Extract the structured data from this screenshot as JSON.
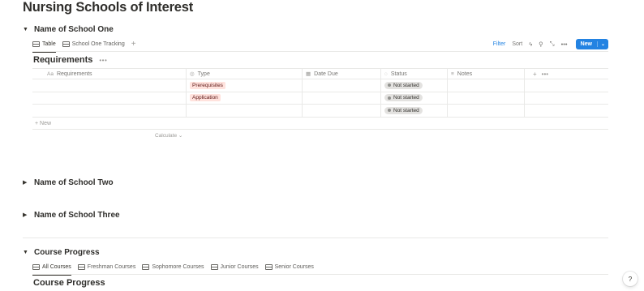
{
  "page": {
    "title": "Nursing Schools of Interest"
  },
  "school_one": {
    "title": "Name of School One",
    "tabs": [
      {
        "label": "Table",
        "icon": "table-icon"
      },
      {
        "label": "School One Tracking",
        "icon": "table-icon"
      }
    ],
    "toolbar": {
      "filter_label": "Filter",
      "sort_label": "Sort",
      "new_label": "New",
      "icons": [
        "lightning-icon",
        "search-icon",
        "expand-icon",
        "more-icon"
      ]
    },
    "database": {
      "title": "Requirements",
      "columns": [
        {
          "label": "Requirements",
          "icon": "text-icon"
        },
        {
          "label": "Type",
          "icon": "select-icon"
        },
        {
          "label": "Date Due",
          "icon": "calendar-icon"
        },
        {
          "label": "Status",
          "icon": "status-icon"
        },
        {
          "label": "Notes",
          "icon": "notes-icon"
        }
      ],
      "rows": [
        {
          "requirements": "",
          "type": "Prerequisites",
          "date_due": "",
          "status": "Not started",
          "notes": ""
        },
        {
          "requirements": "",
          "type": "Application",
          "date_due": "",
          "status": "Not started",
          "notes": ""
        },
        {
          "requirements": "",
          "type": "",
          "date_due": "",
          "status": "Not started",
          "notes": ""
        }
      ],
      "new_row_label": "+ New",
      "calculate_label": "Calculate"
    },
    "colors": {
      "accent": "#2383e2",
      "type_tag_bg": "#ffe2dd",
      "status_bg": "#e3e2e0"
    }
  },
  "school_two": {
    "title": "Name of School Two"
  },
  "school_three": {
    "title": "Name of School Three"
  },
  "course_progress": {
    "title": "Course Progress",
    "tabs": [
      {
        "label": "All Courses"
      },
      {
        "label": "Freshman Courses"
      },
      {
        "label": "Sophomore Courses"
      },
      {
        "label": "Junior Courses"
      },
      {
        "label": "Senior Courses"
      }
    ],
    "database_title": "Course Progress"
  },
  "help": {
    "label": "?"
  }
}
